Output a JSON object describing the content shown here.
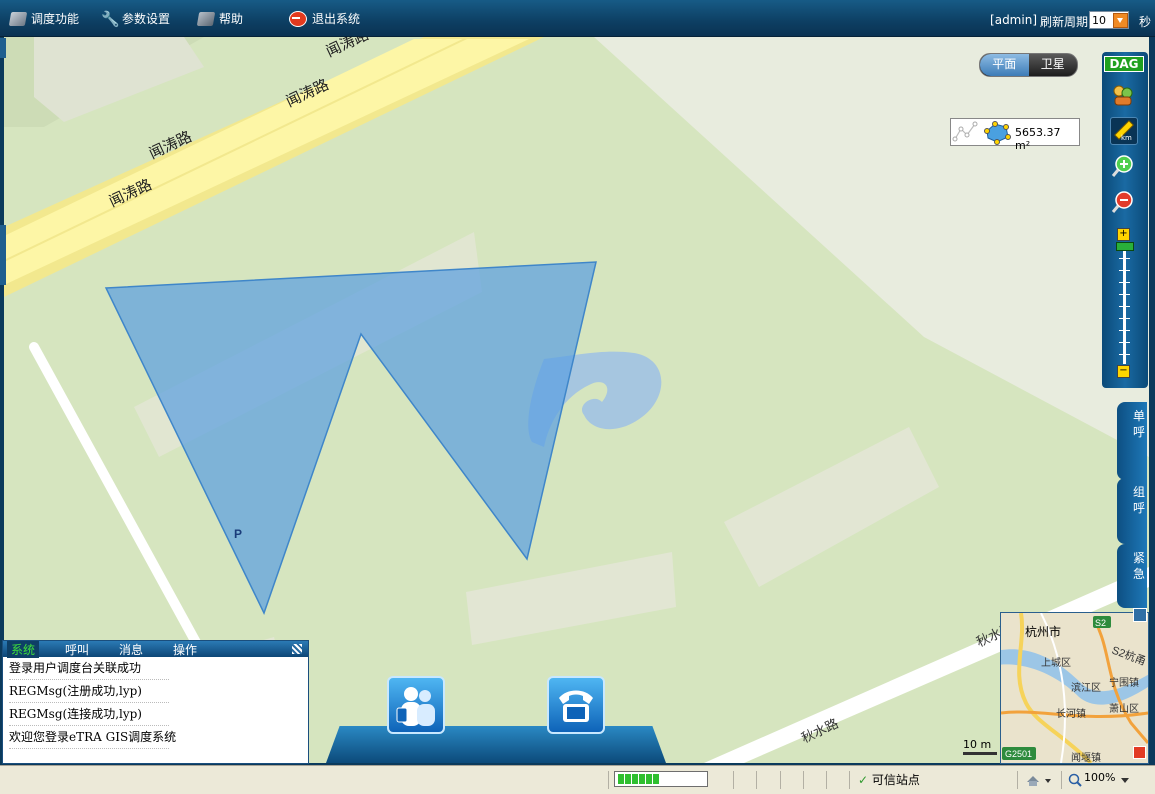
{
  "menu": {
    "dispatch": "调度功能",
    "params": "参数设置",
    "help": "帮助",
    "exit": "退出系统"
  },
  "header": {
    "user": "[admin]",
    "refresh_label": "刷新周期",
    "refresh_value": "10",
    "refresh_unit": "秒"
  },
  "map": {
    "view_tabs": [
      "平面",
      "卫星"
    ],
    "road_name": "闻涛路",
    "road_name_2": "秋水路",
    "road_name_3": "秋水路",
    "parking_label": "P",
    "measure_value": "5653.37 m²",
    "scale_label": "10 m"
  },
  "toolbar": {
    "dag_label": "DAG"
  },
  "side_tabs": [
    "单呼",
    "组呼",
    "紧急"
  ],
  "overview": {
    "city": "杭州市",
    "road_s2": "S2",
    "road_s2_name": "S2杭甬",
    "district_1": "上城区",
    "district_2": "滨江区",
    "district_3": "宁围镇",
    "district_4": "长河镇",
    "district_5": "萧山区",
    "district_6": "闻堰镇",
    "highway": "G2501"
  },
  "log": {
    "tabs": [
      "系统",
      "呼叫",
      "消息",
      "操作"
    ],
    "lines": [
      "登录用户调度台关联成功",
      "REGMsg(注册成功,lyp)",
      "REGMsg(连接成功,lyp)",
      "欢迎您登录eTRA GIS调度系统"
    ]
  },
  "status": {
    "progress_blocks": 6,
    "trusted_site": "可信站点",
    "zoom": "100%"
  },
  "colors": {
    "header_bg": "#0d3f63",
    "map_bg": "#d6e5bf",
    "polygon_fill": "#5b9fe0",
    "road": "#fdf6a6"
  }
}
